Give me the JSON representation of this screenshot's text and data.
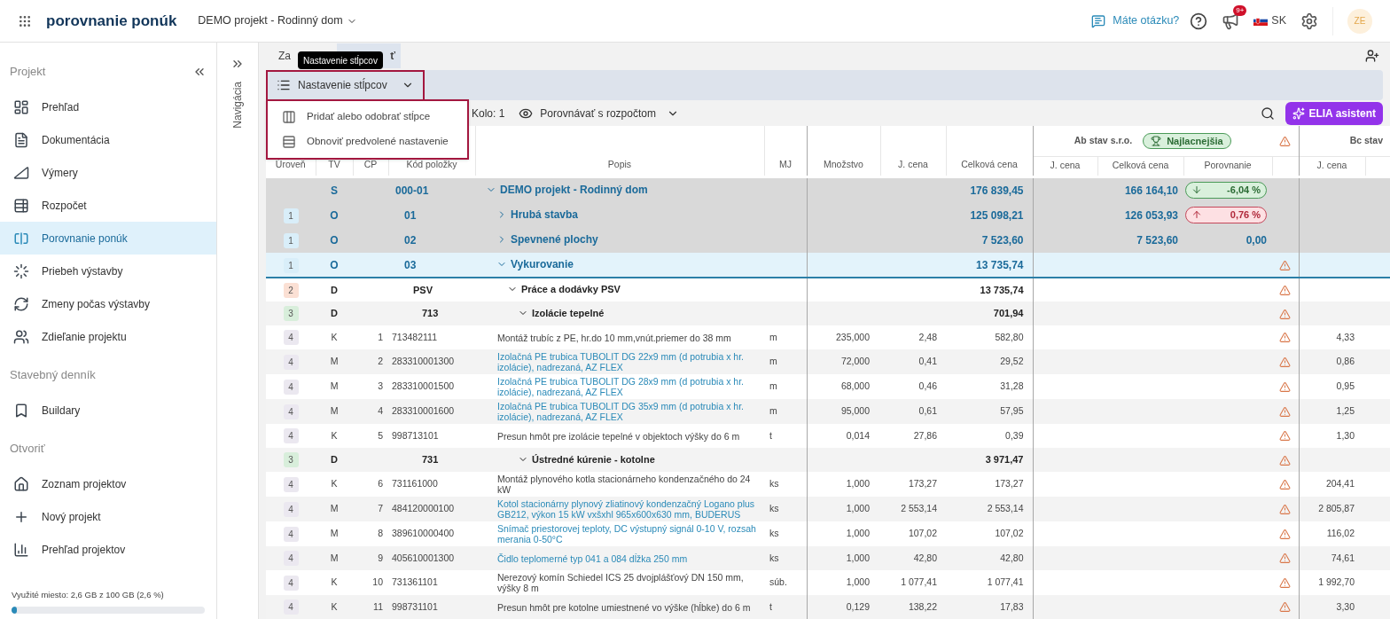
{
  "header": {
    "app_title": "porovnanie ponúk",
    "project": "DEMO projekt - Rodinný dom",
    "help_link": "Máte otázku?",
    "notification_badge": "9+",
    "language": "SK",
    "avatar": "ZE"
  },
  "sidebar": {
    "sections": [
      {
        "title": "Projekt",
        "items": [
          {
            "label": "Prehľad",
            "selected": false
          },
          {
            "label": "Dokumentácia",
            "selected": false
          },
          {
            "label": "Výmery",
            "selected": false
          },
          {
            "label": "Rozpočet",
            "selected": false
          },
          {
            "label": "Porovnanie ponúk",
            "selected": true
          },
          {
            "label": "Priebeh výstavby",
            "selected": false
          },
          {
            "label": "Zmeny počas výstavby",
            "selected": false
          },
          {
            "label": "Zdieľanie projektu",
            "selected": false
          }
        ]
      },
      {
        "title": "Stavebný denník",
        "items": [
          {
            "label": "Buildary",
            "selected": false
          }
        ]
      },
      {
        "title": "Otvoriť",
        "items": [
          {
            "label": "Zoznam projektov",
            "selected": false
          },
          {
            "label": "Nový projekt",
            "selected": false
          },
          {
            "label": "Prehľad projektov",
            "selected": false
          }
        ]
      }
    ],
    "storage": {
      "text": "Využité miesto: 2,6 GB z 100 GB (2,6 %)",
      "level": 0.026
    }
  },
  "navigation_strip": {
    "label": "Navigácia"
  },
  "tabs": [
    {
      "label": "Za",
      "selected": false
    },
    {
      "label": "ť",
      "selected": true
    }
  ],
  "tooltip": "Nastavenie stĺpcov",
  "toolbar": {
    "column_settings_button": "Nastavenie stĺpcov",
    "menu": [
      "Pridať alebo odobrať stĺpce",
      "Obnoviť predvolené nastavenie"
    ],
    "round": "Kolo: 1",
    "compare": "Porovnávať s rozpočtom",
    "assistant_button": "ELIA asistent"
  },
  "table": {
    "columns": [
      "Úroveň",
      "TV",
      "CP",
      "Kód položky",
      "Popis",
      "MJ",
      "Množstvo",
      "J. cena",
      "Celková cena"
    ],
    "bidders": [
      {
        "name": "Ab stav s.r.o.",
        "badge": "Najlacnejšia",
        "warning": true,
        "columns": [
          "J. cena",
          "Celková cena",
          "Porovnanie"
        ]
      },
      {
        "name": "Bc stav",
        "columns": [
          "J. cena"
        ]
      }
    ],
    "rows": [
      {
        "kind": "object",
        "selected": false,
        "expanded": true,
        "tv": "S",
        "code": "000-01",
        "popis": "DEMO projekt - Rodinný dom",
        "total": "176 839,45",
        "ab_total": "166 164,10",
        "comparison": {
          "text": "-6,04 %",
          "kind": "decrease"
        },
        "warning": false,
        "children": [
          {
            "kind": "object",
            "selected": false,
            "expanded": false,
            "level": "1",
            "color": "#d9eef9",
            "tv": "O",
            "code": "01",
            "popis": "Hrubá stavba",
            "total": "125 098,21",
            "ab_total": "126 053,93",
            "comparison": {
              "text": "0,76 %",
              "kind": "increase"
            },
            "warning": false
          },
          {
            "kind": "object",
            "selected": false,
            "expanded": false,
            "level": "1",
            "color": "#d9eef9",
            "tv": "O",
            "code": "02",
            "popis": "Spevnené plochy",
            "total": "7 523,60",
            "ab_total": "7 523,60",
            "comparison": {
              "text": "0,00",
              "kind": "equal"
            },
            "warning": false
          },
          {
            "kind": "object",
            "selected": true,
            "expanded": true,
            "level": "1",
            "color": "#d9eef9",
            "tv": "O",
            "code": "03",
            "popis": "Vykurovanie",
            "total": "13 735,74",
            "warning": true,
            "children": [
              {
                "kind": "section",
                "selected": false,
                "expanded": true,
                "level": "2",
                "color": "#fbe0d4",
                "tv": "D",
                "code": "PSV",
                "popis": "Práce a dodávky PSV",
                "total": "13 735,74",
                "warning": true,
                "children": [
                  {
                    "kind": "section",
                    "selected": false,
                    "expanded": true,
                    "level": "3",
                    "color": "#d8eedb",
                    "tv": "D",
                    "code": "713",
                    "popis": "Izolácie tepelné",
                    "total": "701,94",
                    "warning": true,
                    "children": [
                      {
                        "kind": "work",
                        "selected": false,
                        "level": "4",
                        "color": "#ebe8f0",
                        "tv": "K",
                        "cp": "1",
                        "code": "713482111",
                        "popis": "Montáž trubíc z PE, hr.do 10 mm,vnút.priemer do 38 mm",
                        "mj": "m",
                        "qty": "235,000",
                        "unit_price": "2,48",
                        "total": "582,80",
                        "warning": true,
                        "bc_unit": "4,33"
                      },
                      {
                        "kind": "material",
                        "selected": false,
                        "level": "4",
                        "color": "#ebe8f0",
                        "tv": "M",
                        "cp": "2",
                        "code": "283310001300",
                        "popis": "Izolačná PE trubica TUBOLIT DG 22x9 mm (d potrubia x hr. izolácie), nadrezaná, AZ FLEX",
                        "mj": "m",
                        "qty": "72,000",
                        "unit_price": "0,41",
                        "total": "29,52",
                        "warning": true,
                        "bc_unit": "0,86"
                      },
                      {
                        "kind": "material",
                        "selected": false,
                        "level": "4",
                        "color": "#ebe8f0",
                        "tv": "M",
                        "cp": "3",
                        "code": "283310001500",
                        "popis": "Izolačná PE trubica TUBOLIT DG 28x9 mm (d potrubia x hr. izolácie), nadrezaná, AZ FLEX",
                        "mj": "m",
                        "qty": "68,000",
                        "unit_price": "0,46",
                        "total": "31,28",
                        "warning": true,
                        "bc_unit": "0,95"
                      },
                      {
                        "kind": "material",
                        "selected": false,
                        "level": "4",
                        "color": "#ebe8f0",
                        "tv": "M",
                        "cp": "4",
                        "code": "283310001600",
                        "popis": "Izolačná PE trubica TUBOLIT DG 35x9 mm (d potrubia x hr. izolácie), nadrezaná, AZ FLEX",
                        "mj": "m",
                        "qty": "95,000",
                        "unit_price": "0,61",
                        "total": "57,95",
                        "warning": true,
                        "bc_unit": "1,25"
                      },
                      {
                        "kind": "work",
                        "selected": false,
                        "level": "4",
                        "color": "#ebe8f0",
                        "tv": "K",
                        "cp": "5",
                        "code": "998713101",
                        "popis": "Presun hmôt pre izolácie tepelné v objektoch výšky do 6 m",
                        "mj": "t",
                        "qty": "0,014",
                        "unit_price": "27,86",
                        "total": "0,39",
                        "warning": true,
                        "bc_unit": "1,30"
                      }
                    ]
                  },
                  {
                    "kind": "section",
                    "selected": false,
                    "expanded": true,
                    "level": "3",
                    "color": "#d8eedb",
                    "tv": "D",
                    "code": "731",
                    "popis": "Ústredné kúrenie - kotolne",
                    "total": "3 971,47",
                    "warning": true,
                    "children": [
                      {
                        "kind": "work",
                        "selected": false,
                        "level": "4",
                        "color": "#ebe8f0",
                        "tv": "K",
                        "cp": "6",
                        "code": "731161000",
                        "popis": "Montáž plynového kotla stacionárneho kondenzačného do 24 kW",
                        "mj": "ks",
                        "qty": "1,000",
                        "unit_price": "173,27",
                        "total": "173,27",
                        "warning": true,
                        "bc_unit": "204,41"
                      },
                      {
                        "kind": "material",
                        "selected": false,
                        "level": "4",
                        "color": "#ebe8f0",
                        "tv": "M",
                        "cp": "7",
                        "code": "484120000100",
                        "popis": "Kotol stacionárny plynový zliatinový kondenzačný Logano plus GB212, výkon 15 kW vxšxhl 965x600x630 mm, BUDERUS",
                        "mj": "ks",
                        "qty": "1,000",
                        "unit_price": "2 553,14",
                        "total": "2 553,14",
                        "warning": true,
                        "bc_unit": "2 805,87"
                      },
                      {
                        "kind": "material",
                        "selected": false,
                        "level": "4",
                        "color": "#ebe8f0",
                        "tv": "M",
                        "cp": "8",
                        "code": "389610000400",
                        "popis": "Snímač priestorovej teploty, DC výstupný signál 0-10 V, rozsah merania 0-50°C",
                        "mj": "ks",
                        "qty": "1,000",
                        "unit_price": "107,02",
                        "total": "107,02",
                        "warning": true,
                        "bc_unit": "116,02"
                      },
                      {
                        "kind": "material",
                        "selected": false,
                        "level": "4",
                        "color": "#ebe8f0",
                        "tv": "M",
                        "cp": "9",
                        "code": "405610001300",
                        "popis": "Čidlo teplomerné typ 041 a 084 dĺžka 250 mm",
                        "mj": "ks",
                        "qty": "1,000",
                        "unit_price": "42,80",
                        "total": "42,80",
                        "warning": true,
                        "bc_unit": "74,61"
                      },
                      {
                        "kind": "work",
                        "selected": false,
                        "level": "4",
                        "color": "#ebe8f0",
                        "tv": "K",
                        "cp": "10",
                        "code": "731361101",
                        "popis": "Nerezový komín Schiedel ICS 25 dvojplášťový DN 150 mm, výšky 8 m",
                        "mj": "súb.",
                        "qty": "1,000",
                        "unit_price": "1 077,41",
                        "total": "1 077,41",
                        "warning": true,
                        "bc_unit": "1 992,70"
                      },
                      {
                        "kind": "work",
                        "selected": false,
                        "level": "4",
                        "color": "#ebe8f0",
                        "tv": "K",
                        "cp": "11",
                        "code": "998731101",
                        "popis": "Presun hmôt pre kotolne umiestnené vo výške (hĺbke) do 6 m",
                        "mj": "t",
                        "qty": "0,129",
                        "unit_price": "138,22",
                        "total": "17,83",
                        "warning": true,
                        "bc_unit": "3,30"
                      }
                    ]
                  }
                ]
              }
            ]
          }
        ]
      }
    ]
  }
}
